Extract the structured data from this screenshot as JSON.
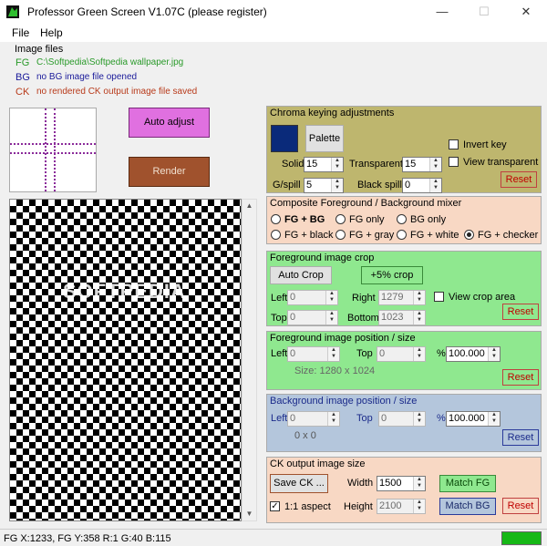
{
  "window": {
    "title": "Professor Green Screen V1.07C (please register)",
    "minimize": "—",
    "maximize": "☐",
    "close": "✕"
  },
  "menu": {
    "file": "File",
    "help": "Help"
  },
  "image_files": {
    "heading": "Image files",
    "fg_tag": "FG",
    "fg_text": "C:\\Softpedia\\Softpedia wallpaper.jpg",
    "bg_tag": "BG",
    "bg_text": "no BG image file opened",
    "ck_tag": "CK",
    "ck_text": "no rendered CK output image file saved"
  },
  "buttons": {
    "auto_adjust": "Auto adjust",
    "render": "Render"
  },
  "watermark": "SOFTPEDIA",
  "chroma": {
    "title": "Chroma keying adjustments",
    "palette": "Palette",
    "invert_key": "Invert key",
    "view_transparent": "View transparent",
    "solid_label": "Solid",
    "solid_value": "15",
    "transparent_label": "Transparent",
    "transparent_value": "15",
    "gspill_label": "G/spill",
    "gspill_value": "5",
    "blackspill_label": "Black spill",
    "blackspill_value": "0",
    "reset": "Reset",
    "key_color": "#0a2a7a"
  },
  "mixer": {
    "title": "Composite Foreground / Background mixer",
    "options": [
      "FG + BG",
      "FG only",
      "BG only",
      "FG + black",
      "FG + gray",
      "FG + white",
      "FG + checker"
    ],
    "selected": "FG + checker"
  },
  "crop": {
    "title": "Foreground image crop",
    "auto_crop": "Auto Crop",
    "plus5": "+5% crop",
    "left_label": "Left",
    "left_value": "0",
    "right_label": "Right",
    "right_value": "1279",
    "top_label": "Top",
    "top_value": "0",
    "bottom_label": "Bottom",
    "bottom_value": "1023",
    "view_crop": "View crop area",
    "reset": "Reset"
  },
  "fgpos": {
    "title": "Foreground image position / size",
    "left_label": "Left",
    "left_value": "0",
    "top_label": "Top",
    "top_value": "0",
    "pct": "%",
    "pct_value": "100.000",
    "size": "Size: 1280 x 1024",
    "reset": "Reset"
  },
  "bgpos": {
    "title": "Background image position / size",
    "left_label": "Left",
    "left_value": "0",
    "top_label": "Top",
    "top_value": "0",
    "pct": "%",
    "pct_value": "100.000",
    "size": "0 x 0",
    "reset": "Reset"
  },
  "ckout": {
    "title": "CK output image size",
    "save": "Save CK ...",
    "width_label": "Width",
    "width_value": "1500",
    "match_fg": "Match FG",
    "aspect": "1:1 aspect",
    "height_label": "Height",
    "height_value": "2100",
    "match_bg": "Match BG",
    "reset": "Reset"
  },
  "status": {
    "text": "FG X:1233, FG Y:358 R:1 G:40 B:115",
    "indicator_color": "#16b816"
  }
}
